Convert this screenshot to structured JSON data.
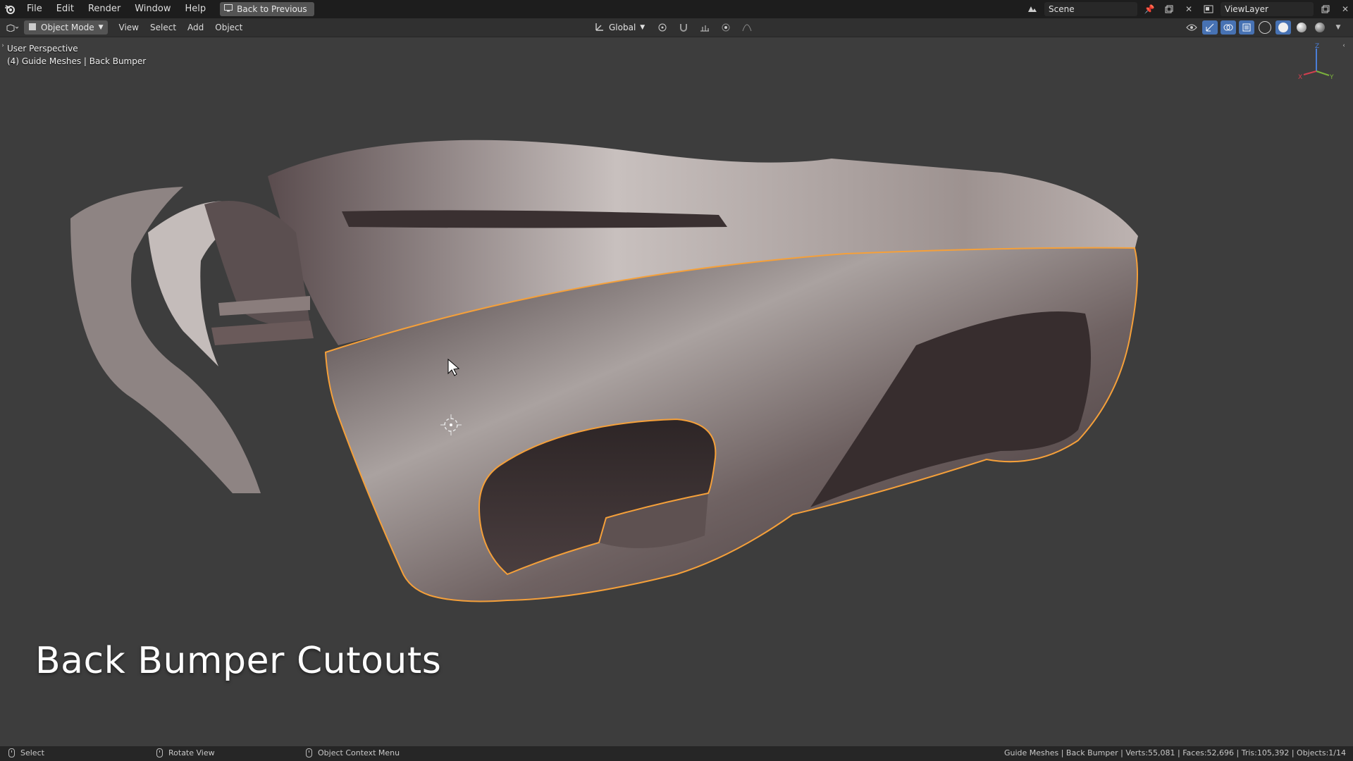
{
  "topbar": {
    "menus": [
      "File",
      "Edit",
      "Render",
      "Window",
      "Help"
    ],
    "back_button": "Back to Previous",
    "scene": "Scene",
    "view_layer": "ViewLayer"
  },
  "header": {
    "mode": "Object Mode",
    "menus": [
      "View",
      "Select",
      "Add",
      "Object"
    ],
    "orientation": "Global"
  },
  "viewport": {
    "perspective": "User Perspective",
    "collection_info": "(4) Guide Meshes | Back Bumper",
    "caption": "Back Bumper Cutouts",
    "gizmo_axes": [
      "X",
      "Y",
      "Z"
    ]
  },
  "status": {
    "left_click": "Select",
    "middle_click": "Rotate View",
    "right_click": "Object Context Menu",
    "stats": "Guide Meshes | Back Bumper | Verts:55,081 | Faces:52,696 | Tris:105,392 | Objects:1/14"
  },
  "colors": {
    "selection_outline": "#f5a03a",
    "viewport_bg": "#3d3d3d",
    "topbar_bg": "#1d1d1d"
  }
}
